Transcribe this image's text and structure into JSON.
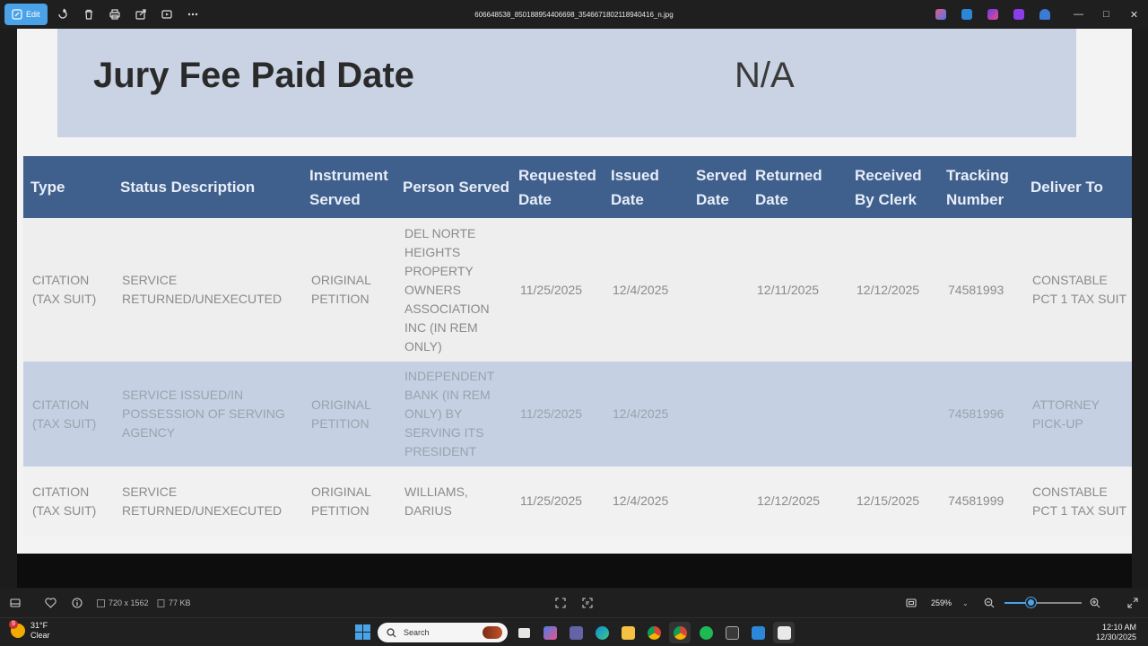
{
  "titlebar": {
    "edit_label": "Edit",
    "filename": "606648538_850188954406698_3546671802118940416_n.jpg",
    "controls": [
      "minimize-icon",
      "maximize-icon",
      "close-icon"
    ]
  },
  "document": {
    "jury_label": "Jury Fee Paid Date",
    "jury_value": "N/A",
    "headers": [
      "Type",
      "Status Description",
      "Instrument Served",
      "Person Served",
      "Requested Date",
      "Issued Date",
      "Served Date",
      "Returned Date",
      "Received By Clerk",
      "Tracking Number",
      "Deliver To"
    ],
    "rows": [
      {
        "type": "CITATION (TAX SUIT)",
        "status": "SERVICE RETURNED/UNEXECUTED",
        "instrument": "ORIGINAL PETITION",
        "person": "DEL NORTE HEIGHTS PROPERTY OWNERS ASSOCIATION INC (IN REM ONLY)",
        "requested": "11/25/2025",
        "issued": "12/4/2025",
        "served": "",
        "returned": "12/11/2025",
        "received": "12/12/2025",
        "tracking": "74581993",
        "deliver": "CONSTABLE PCT 1 TAX SUIT"
      },
      {
        "type": "CITATION (TAX SUIT)",
        "status": "SERVICE ISSUED/IN POSSESSION OF SERVING AGENCY",
        "instrument": "ORIGINAL PETITION",
        "person": "INDEPENDENT BANK (IN REM ONLY) BY SERVING ITS PRESIDENT",
        "requested": "11/25/2025",
        "issued": "12/4/2025",
        "served": "",
        "returned": "",
        "received": "",
        "tracking": "74581996",
        "deliver": "ATTORNEY PICK-UP"
      },
      {
        "type": "CITATION (TAX SUIT)",
        "status": "SERVICE RETURNED/UNEXECUTED",
        "instrument": "ORIGINAL PETITION",
        "person": "WILLIAMS, DARIUS",
        "requested": "11/25/2025",
        "issued": "12/4/2025",
        "served": "",
        "returned": "12/12/2025",
        "received": "12/15/2025",
        "tracking": "74581999",
        "deliver": "CONSTABLE PCT 1 TAX SUIT"
      }
    ]
  },
  "statusbar": {
    "dimensions": "720 x 1562",
    "filesize": "77 KB",
    "zoom": "259%",
    "zoom_level_fraction": 0.35
  },
  "taskbar": {
    "temperature": "31°F",
    "condition": "Clear",
    "weather_badge": "9",
    "search_placeholder": "Search",
    "time": "12:10 AM",
    "date": "12/30/2025"
  },
  "colors": {
    "accent": "#4aa3e8",
    "table_header": "#3f5f8c",
    "highlight_row": "#c5d1e2",
    "jury_box": "#c9d3e3"
  }
}
